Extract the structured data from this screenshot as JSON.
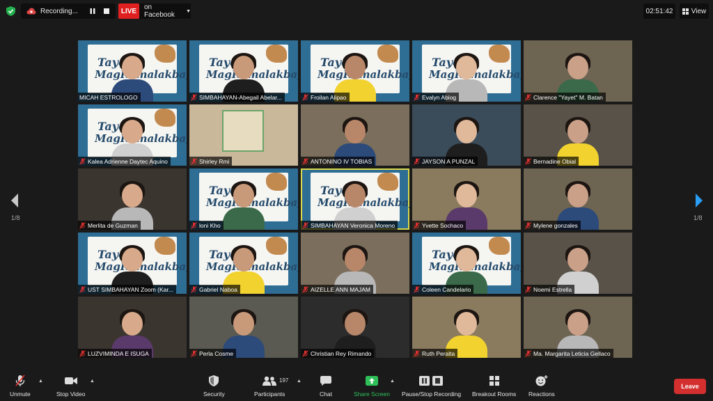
{
  "topbar": {
    "recording_label": "Recording...",
    "live_label": "LIVE",
    "live_destination": "on Facebook",
    "timer": "02:51:42",
    "view_label": "View"
  },
  "pagination": {
    "left": "1/8",
    "right": "1/8"
  },
  "banner": {
    "title_line1": "Tayo",
    "title_line2": "MagKamalakbay"
  },
  "participants": [
    {
      "name": "MICAH ESTROLOGO",
      "banner": true,
      "muted": false
    },
    {
      "name": "SIMBAHAYAN-Abegail Abelar...",
      "banner": true,
      "muted": true
    },
    {
      "name": "Froilan Alipao",
      "banner": true,
      "muted": true
    },
    {
      "name": "Evalyn Abiog",
      "banner": true,
      "muted": true
    },
    {
      "name": "Clarence \"Yayet\" M. Batan",
      "banner": false,
      "muted": true
    },
    {
      "name": "Kalea Adrienne Daytec Aquino",
      "banner": true,
      "muted": true
    },
    {
      "name": "Shirley Rmi",
      "banner": false,
      "muted": true
    },
    {
      "name": "ANTONINO IV TOBIAS",
      "banner": false,
      "muted": true
    },
    {
      "name": "JAYSON A PUNZAL",
      "banner": false,
      "muted": true
    },
    {
      "name": "Bernadine Obial",
      "banner": false,
      "muted": true
    },
    {
      "name": "Merlita de Guzman",
      "banner": false,
      "muted": true
    },
    {
      "name": "loni Kho",
      "banner": true,
      "muted": true
    },
    {
      "name": "SIMBAHAYAN Veronica Moreno",
      "banner": true,
      "muted": true
    },
    {
      "name": "Yvette Sochaco",
      "banner": false,
      "muted": true
    },
    {
      "name": "Mylene gonzales",
      "banner": false,
      "muted": true
    },
    {
      "name": "UST SIMBAHAYAN Zoom (Kar...",
      "banner": true,
      "muted": true
    },
    {
      "name": "Gabriel Naboa",
      "banner": true,
      "muted": true
    },
    {
      "name": "AIZELLE ANN MAJAM",
      "banner": false,
      "muted": true
    },
    {
      "name": "Coleen Candelario",
      "banner": true,
      "muted": true
    },
    {
      "name": "Noemi Estrella",
      "banner": false,
      "muted": true
    },
    {
      "name": "LUZVIMINDA E ISUGA",
      "banner": false,
      "muted": true
    },
    {
      "name": "Perla Cosme",
      "banner": false,
      "muted": true
    },
    {
      "name": "Christian Rey Rimando",
      "banner": false,
      "muted": true
    },
    {
      "name": "Ruth Peralta",
      "banner": false,
      "muted": true
    },
    {
      "name": "Ma. Margarita Leticia Gellaco",
      "banner": false,
      "muted": true
    }
  ],
  "toolbar": {
    "unmute": "Unmute",
    "stop_video": "Stop Video",
    "security": "Security",
    "participants": "Participants",
    "participants_count": "197",
    "chat": "Chat",
    "share_screen": "Share Screen",
    "pause_stop_recording": "Pause/Stop Recording",
    "breakout_rooms": "Breakout Rooms",
    "reactions": "Reactions",
    "leave": "Leave"
  },
  "colors": {
    "live": "#e02020",
    "share": "#2fc05a",
    "leave": "#d32f2f",
    "active_speaker": "#d9d94a",
    "muted_mic": "#e03030"
  }
}
